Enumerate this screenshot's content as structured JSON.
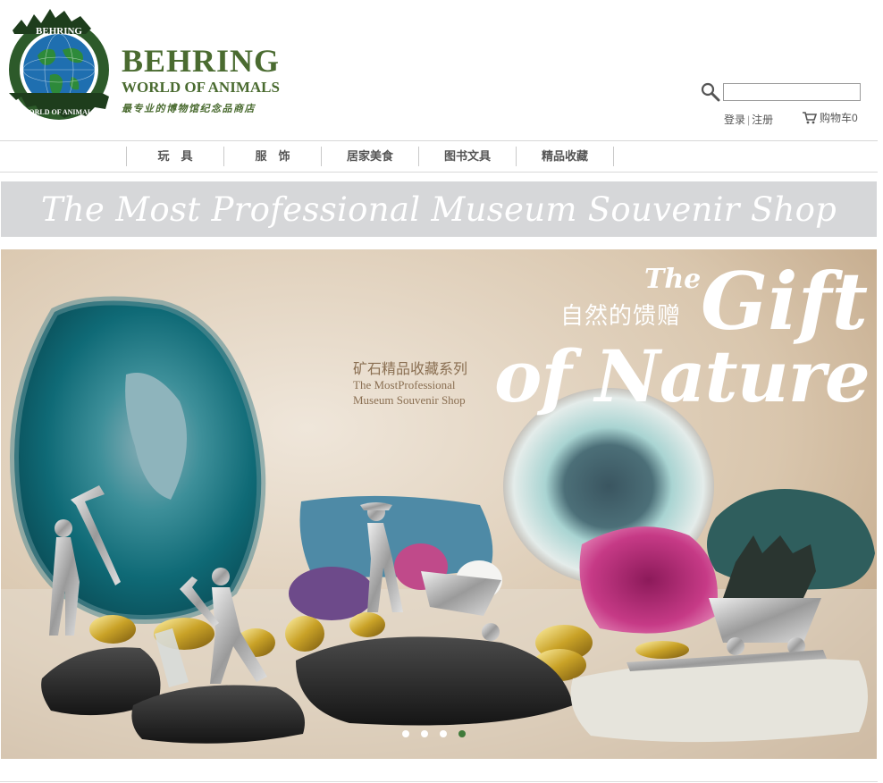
{
  "brand": {
    "name": "BEHRING",
    "subtitle": "WORLD OF ANIMALS",
    "slogan": "最专业的博物馆纪念品商店",
    "logo_ring_text": "BEHRING WORLD OF ANIMALS",
    "color": "#4a6b30"
  },
  "header": {
    "search_placeholder": "",
    "search_icon": "search-icon",
    "login": "登录",
    "separator": "|",
    "register": "注册",
    "cart_icon": "cart-icon",
    "cart_label": "购物车0"
  },
  "nav": {
    "items": [
      {
        "label": "玩　具"
      },
      {
        "label": "服　饰"
      },
      {
        "label": "居家美食"
      },
      {
        "label": "图书文具"
      },
      {
        "label": "精品收藏"
      }
    ]
  },
  "tagline": "The Most Professional Museum Souvenir Shop",
  "hero": {
    "the": "The",
    "cn_title": "自然的馈赠",
    "gift": "Gift",
    "nature": "of Nature",
    "cn_series": "矿石精品收藏系列",
    "en_line1": "The MostProfessional",
    "en_line2": "Museum Souvenir Shop",
    "slides": 4,
    "active_slide": 4
  },
  "colors": {
    "accent": "#3f7a3a",
    "tagline_bg": "#d6d7d9",
    "hero_text_brown": "#8a6f52"
  }
}
